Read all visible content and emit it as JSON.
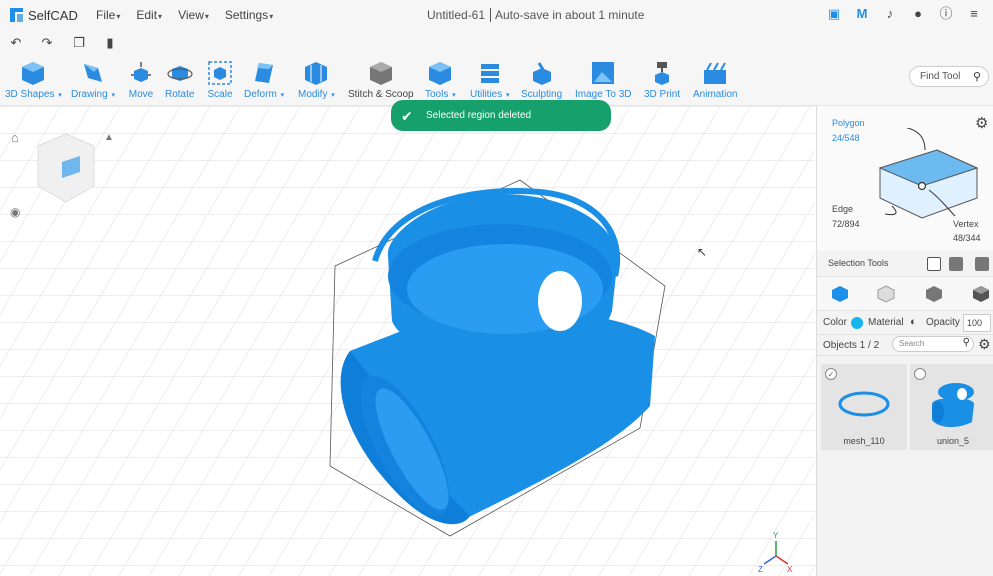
{
  "app": {
    "logo_text": "SelfCAD",
    "document_title": "Untitled-61",
    "autosave_text": "Auto-save in about 1 minute",
    "brand_color": "#1e8fe8"
  },
  "menu": [
    {
      "label": "File"
    },
    {
      "label": "Edit"
    },
    {
      "label": "View"
    },
    {
      "label": "Settings"
    }
  ],
  "top_icons": [
    "save-icon",
    "m-icon",
    "bell-icon",
    "user-icon",
    "info-icon",
    "menu-icon"
  ],
  "top_icon_glyphs": {
    "m": "M"
  },
  "quick_icons": [
    "undo-icon",
    "redo-icon",
    "copy-icon",
    "delete-icon"
  ],
  "toolbar": {
    "items": [
      {
        "label": "3D Shapes",
        "dropdown": true
      },
      {
        "label": "Drawing",
        "dropdown": true
      },
      {
        "label": "Move",
        "dropdown": false
      },
      {
        "label": "Rotate",
        "dropdown": false
      },
      {
        "label": "Scale",
        "dropdown": false
      },
      {
        "label": "Deform",
        "dropdown": true
      },
      {
        "label": "Modify",
        "dropdown": true
      },
      {
        "label": "Stitch & Scoop",
        "dropdown": false
      },
      {
        "label": "Tools",
        "dropdown": true
      },
      {
        "label": "Utilities",
        "dropdown": true
      },
      {
        "label": "Sculpting",
        "dropdown": false
      },
      {
        "label": "Image To 3D",
        "dropdown": false
      },
      {
        "label": "3D Print",
        "dropdown": false
      },
      {
        "label": "Animation",
        "dropdown": false
      }
    ],
    "find_tool_placeholder": "Find Tool"
  },
  "toast": {
    "message": "Selected region deleted",
    "color": "#15a06c"
  },
  "axes": {
    "y": "Y",
    "x": "X",
    "z": "Z"
  },
  "panel": {
    "polygon_label": "Polygon",
    "polygon_count": "24/548",
    "edge_label": "Edge",
    "edge_count": "72/894",
    "vertex_label": "Vertex",
    "vertex_count": "48/344",
    "selection_tools_label": "Selection Tools",
    "color_label": "Color",
    "material_label": "Material",
    "opacity_label": "Opacity",
    "opacity_value": "100",
    "color_swatch": "#16b5f0",
    "objects_label": "Objects 1 / 2",
    "search_placeholder": "Search",
    "objects": [
      {
        "name": "mesh_110",
        "selected": true
      },
      {
        "name": "union_5",
        "selected": false
      }
    ]
  }
}
